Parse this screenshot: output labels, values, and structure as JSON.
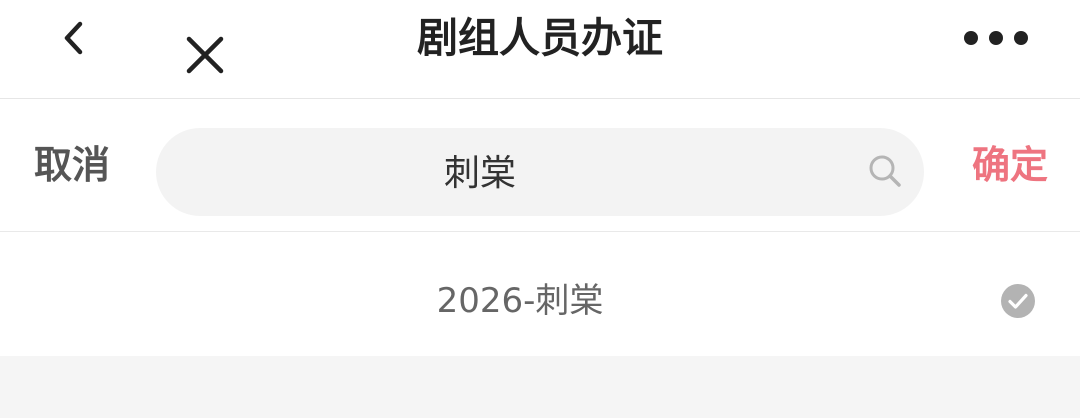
{
  "header": {
    "title": "剧组人员办证"
  },
  "search_bar": {
    "cancel_label": "取消",
    "query": "刺棠",
    "confirm_label": "确定"
  },
  "results": [
    {
      "label": "2026-刺棠",
      "selected": true
    }
  ],
  "colors": {
    "accent": "#ee7480",
    "check_badge": "#b3b3b3"
  },
  "icons": {
    "back": "chevron-left-icon",
    "close": "close-icon",
    "more": "more-dots-icon",
    "search": "search-icon",
    "check": "check-circle-icon"
  }
}
